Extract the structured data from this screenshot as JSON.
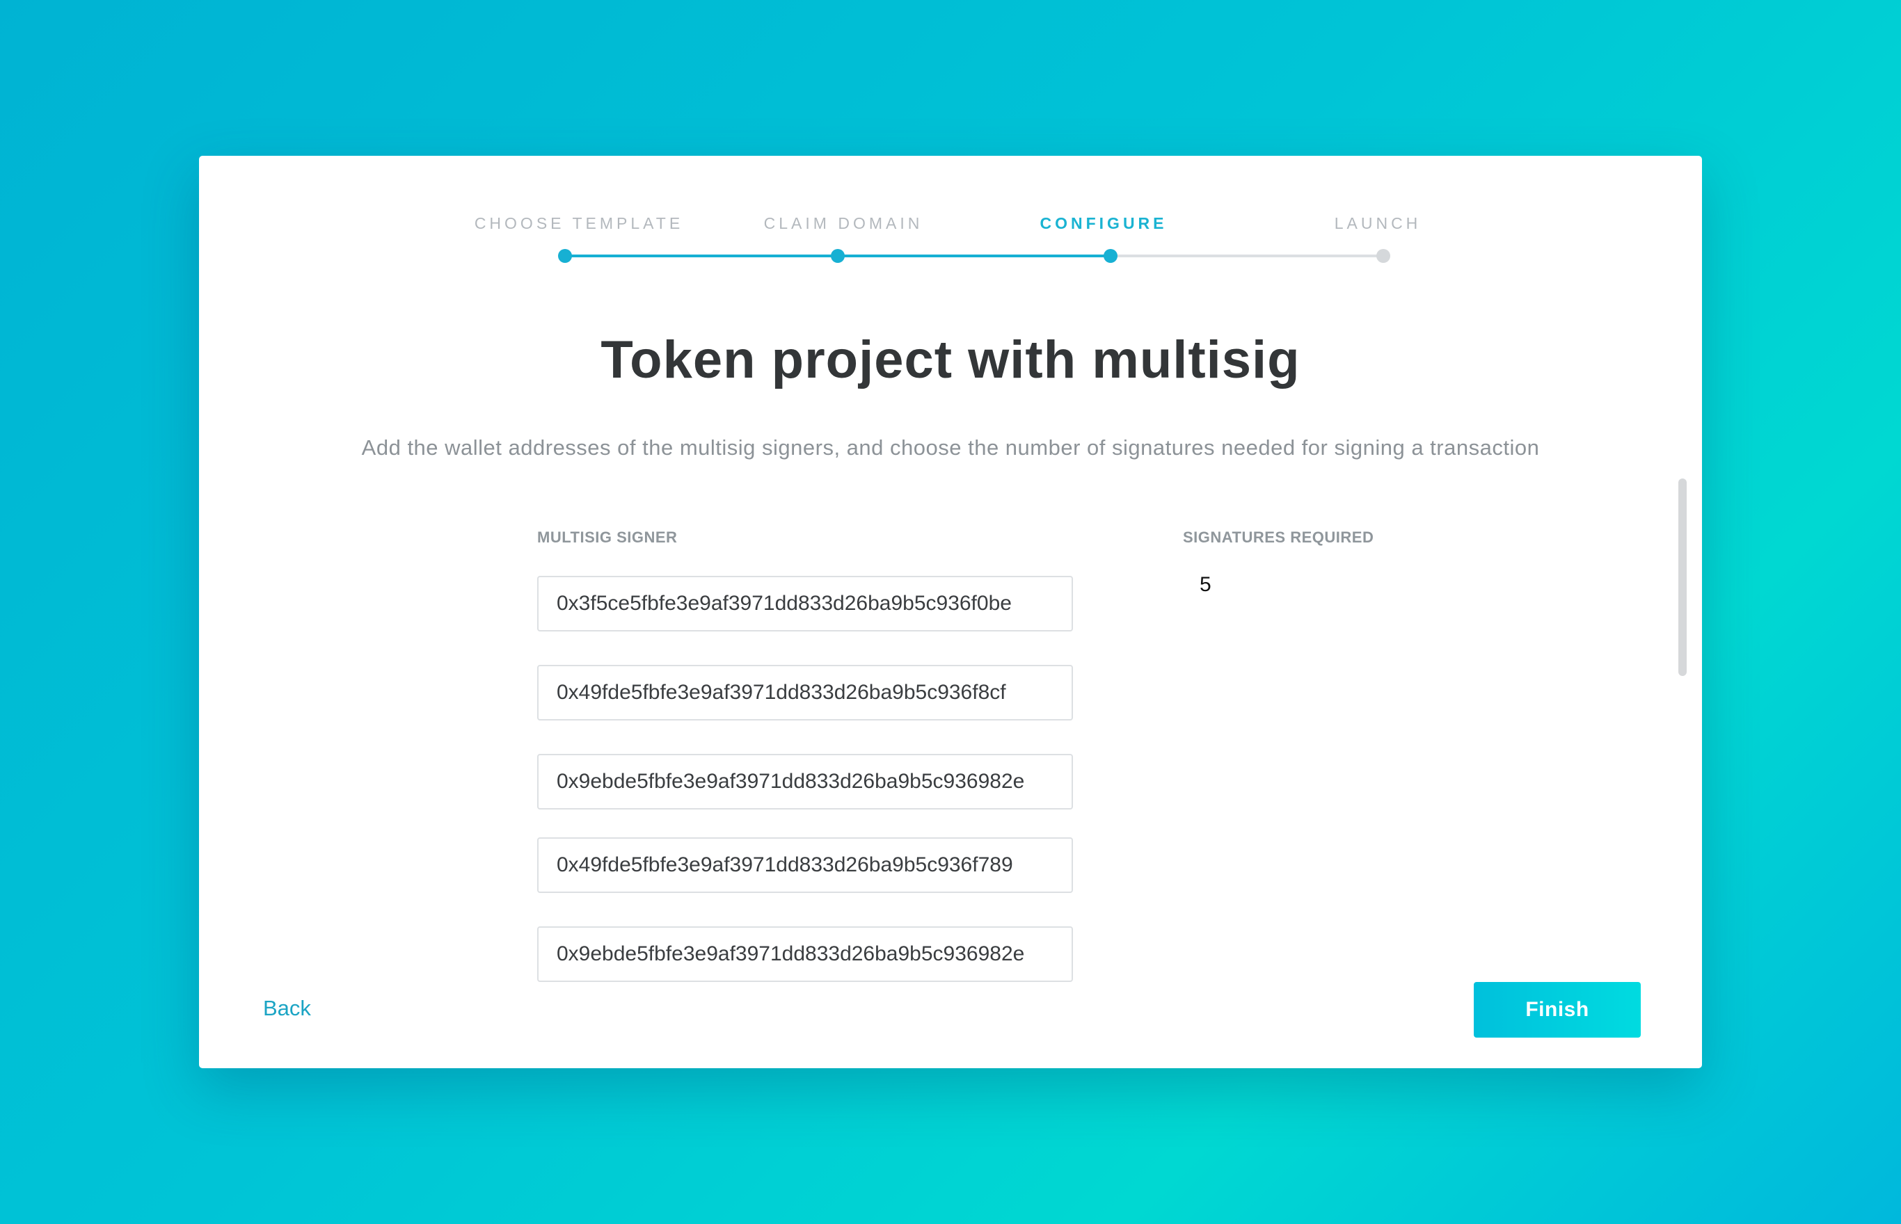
{
  "stepper": {
    "steps": [
      {
        "label": "CHOOSE TEMPLATE",
        "state": "done"
      },
      {
        "label": "CLAIM DOMAIN",
        "state": "done"
      },
      {
        "label": "CONFIGURE",
        "state": "active"
      },
      {
        "label": "LAUNCH",
        "state": "pending"
      }
    ]
  },
  "title": "Token project with multisig",
  "subtitle": "Add the wallet addresses of the multisig signers, and choose the number of signatures needed for signing a transaction",
  "signers": {
    "label": "MULTISIG SIGNER",
    "values": [
      "0x3f5ce5fbfe3e9af3971dd833d26ba9b5c936f0be",
      "0x49fde5fbfe3e9af3971dd833d26ba9b5c936f8cf",
      "0x9ebde5fbfe3e9af3971dd833d26ba9b5c936982e",
      "0x49fde5fbfe3e9af3971dd833d26ba9b5c936f789",
      "0x9ebde5fbfe3e9af3971dd833d26ba9b5c936982e"
    ]
  },
  "signatures": {
    "label": "SIGNATURES REQUIRED",
    "value": "5"
  },
  "footer": {
    "back_label": "Back",
    "finish_label": "Finish"
  },
  "colors": {
    "accent": "#17b0d3",
    "pending": "#dcdfe2",
    "button_start": "#00c0dc",
    "button_end": "#00dbe0"
  }
}
